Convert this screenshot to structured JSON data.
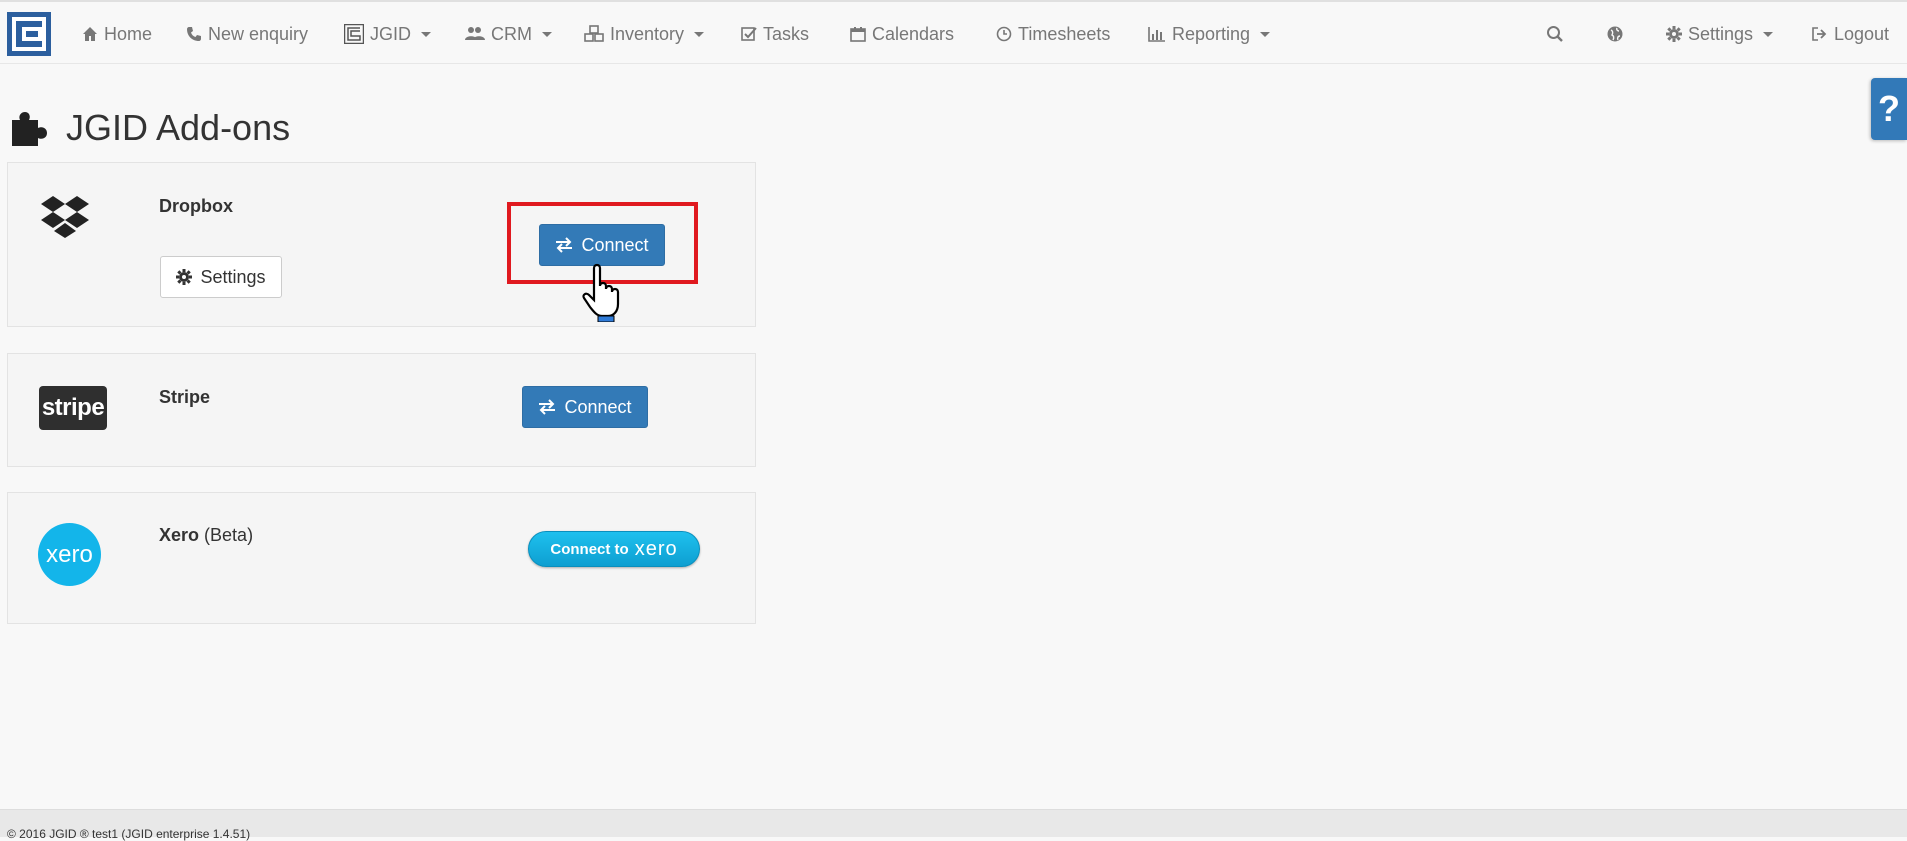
{
  "nav": {
    "home": "Home",
    "new_enquiry": "New enquiry",
    "jgid": "JGID",
    "crm": "CRM",
    "inventory": "Inventory",
    "tasks": "Tasks",
    "calendars": "Calendars",
    "timesheets": "Timesheets",
    "reporting": "Reporting",
    "settings": "Settings",
    "logout": "Logout"
  },
  "help": {
    "label": "?"
  },
  "page": {
    "title": "JGID Add-ons"
  },
  "addons": [
    {
      "name": "Dropbox",
      "connect_label": "Connect",
      "settings_label": "Settings"
    },
    {
      "name": "Stripe",
      "logo_text": "stripe",
      "connect_label": "Connect"
    },
    {
      "name": "Xero",
      "suffix": "(Beta)",
      "logo_text": "xero",
      "connect_prefix": "Connect to",
      "connect_brand": "xero"
    }
  ],
  "footer": {
    "text": "© 2016 JGID ® test1 (JGID enterprise 1.4.51)"
  },
  "colors": {
    "primary": "#337ab7",
    "highlight": "#e0191f",
    "xero": "#13b5ea",
    "stripe": "#2f2f2f"
  }
}
